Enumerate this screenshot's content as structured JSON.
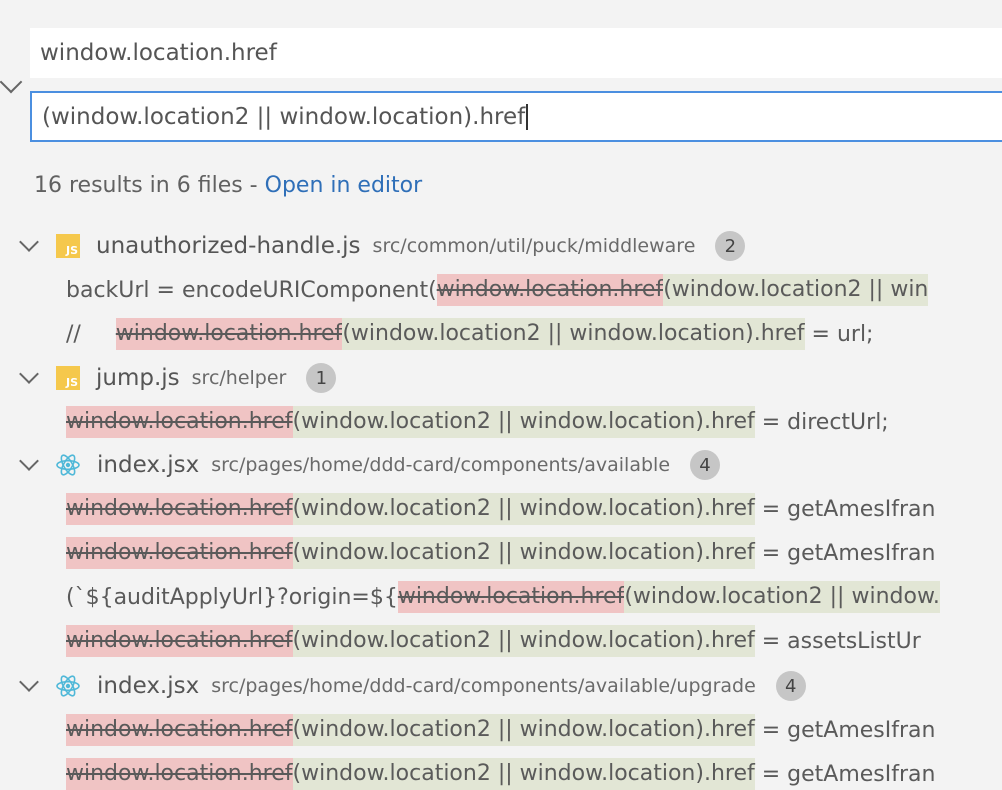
{
  "search": {
    "find_value": "window.location.href",
    "replace_value": "(window.location2 || window.location).href"
  },
  "summary": {
    "text": "16 results in 6 files - ",
    "link": "Open in editor"
  },
  "colors": {
    "removed": "#f0c4c4",
    "inserted": "#e2e6d5",
    "link": "#2f6fb8",
    "focus_border": "#4b8fe0"
  },
  "files": [
    {
      "name": "unauthorized-handle.js",
      "path": "src/common/util/puck/middleware",
      "count": "2",
      "icon": "js-file-icon",
      "matches": [
        {
          "pre": "backUrl = encodeURIComponent(",
          "del": "window.location.href",
          "ins": "(window.location2 || win",
          "post": ""
        },
        {
          "pre": "//     ",
          "del": "window.location.href",
          "ins": "(window.location2 || window.location).href",
          "post": " = url;"
        }
      ]
    },
    {
      "name": "jump.js",
      "path": "src/helper",
      "count": "1",
      "icon": "js-file-icon",
      "matches": [
        {
          "pre": "",
          "del": "window.location.href",
          "ins": "(window.location2 || window.location).href",
          "post": " = directUrl;"
        }
      ]
    },
    {
      "name": "index.jsx",
      "path": "src/pages/home/ddd-card/components/available",
      "count": "4",
      "icon": "react-icon",
      "matches": [
        {
          "pre": "",
          "del": "window.location.href",
          "ins": "(window.location2 || window.location).href",
          "post": " = getAmesIfran"
        },
        {
          "pre": "",
          "del": "window.location.href",
          "ins": "(window.location2 || window.location).href",
          "post": " = getAmesIfran"
        },
        {
          "pre": "(`${auditApplyUrl}?origin=${",
          "del": "window.location.href",
          "ins": "(window.location2 || window.",
          "post": ""
        },
        {
          "pre": "",
          "del": "window.location.href",
          "ins": "(window.location2 || window.location).href",
          "post": " = assetsListUr"
        }
      ]
    },
    {
      "name": "index.jsx",
      "path": "src/pages/home/ddd-card/components/available/upgrade",
      "count": "4",
      "icon": "react-icon",
      "matches": [
        {
          "pre": "",
          "del": "window.location.href",
          "ins": "(window.location2 || window.location).href",
          "post": " = getAmesIfran"
        },
        {
          "pre": "",
          "del": "window.location.href",
          "ins": "(window.location2 || window.location).href",
          "post": " = getAmesIfran"
        }
      ]
    }
  ]
}
